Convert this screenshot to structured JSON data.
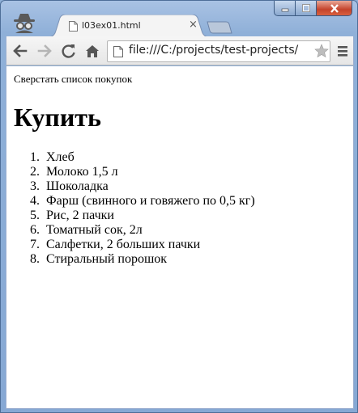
{
  "tab": {
    "title": "l03ex01.html",
    "close_glyph": "×"
  },
  "address_bar": {
    "url": "file:///C:/projects/test-projects/"
  },
  "icons": {
    "incognito": "incognito-icon",
    "back": "back-arrow-icon",
    "forward": "forward-arrow-icon",
    "reload": "reload-icon",
    "home": "home-icon",
    "page": "page-icon",
    "star": "star-icon",
    "menu": "hamburger-menu-icon"
  },
  "page": {
    "caption": "Сверстать список покупок",
    "heading": "Купить",
    "items": [
      {
        "num": "1.",
        "text": "Хлеб"
      },
      {
        "num": "2.",
        "text": "Молоко 1,5 л"
      },
      {
        "num": "3.",
        "text": "Шоколадка"
      },
      {
        "num": "4.",
        "text": "Фарш (свинного и говяжего по 0,5 кг)"
      },
      {
        "num": "5.",
        "text": "Рис, 2 пачки"
      },
      {
        "num": "6.",
        "text": "Томатный сок, 2л"
      },
      {
        "num": "7.",
        "text": "Салфетки, 2 больших пачки"
      },
      {
        "num": "8.",
        "text": "Стиральный порошок"
      }
    ]
  },
  "colors": {
    "frame": "#8fb0d8",
    "close_button": "#c4432b",
    "page_bg": "#ffffff"
  }
}
